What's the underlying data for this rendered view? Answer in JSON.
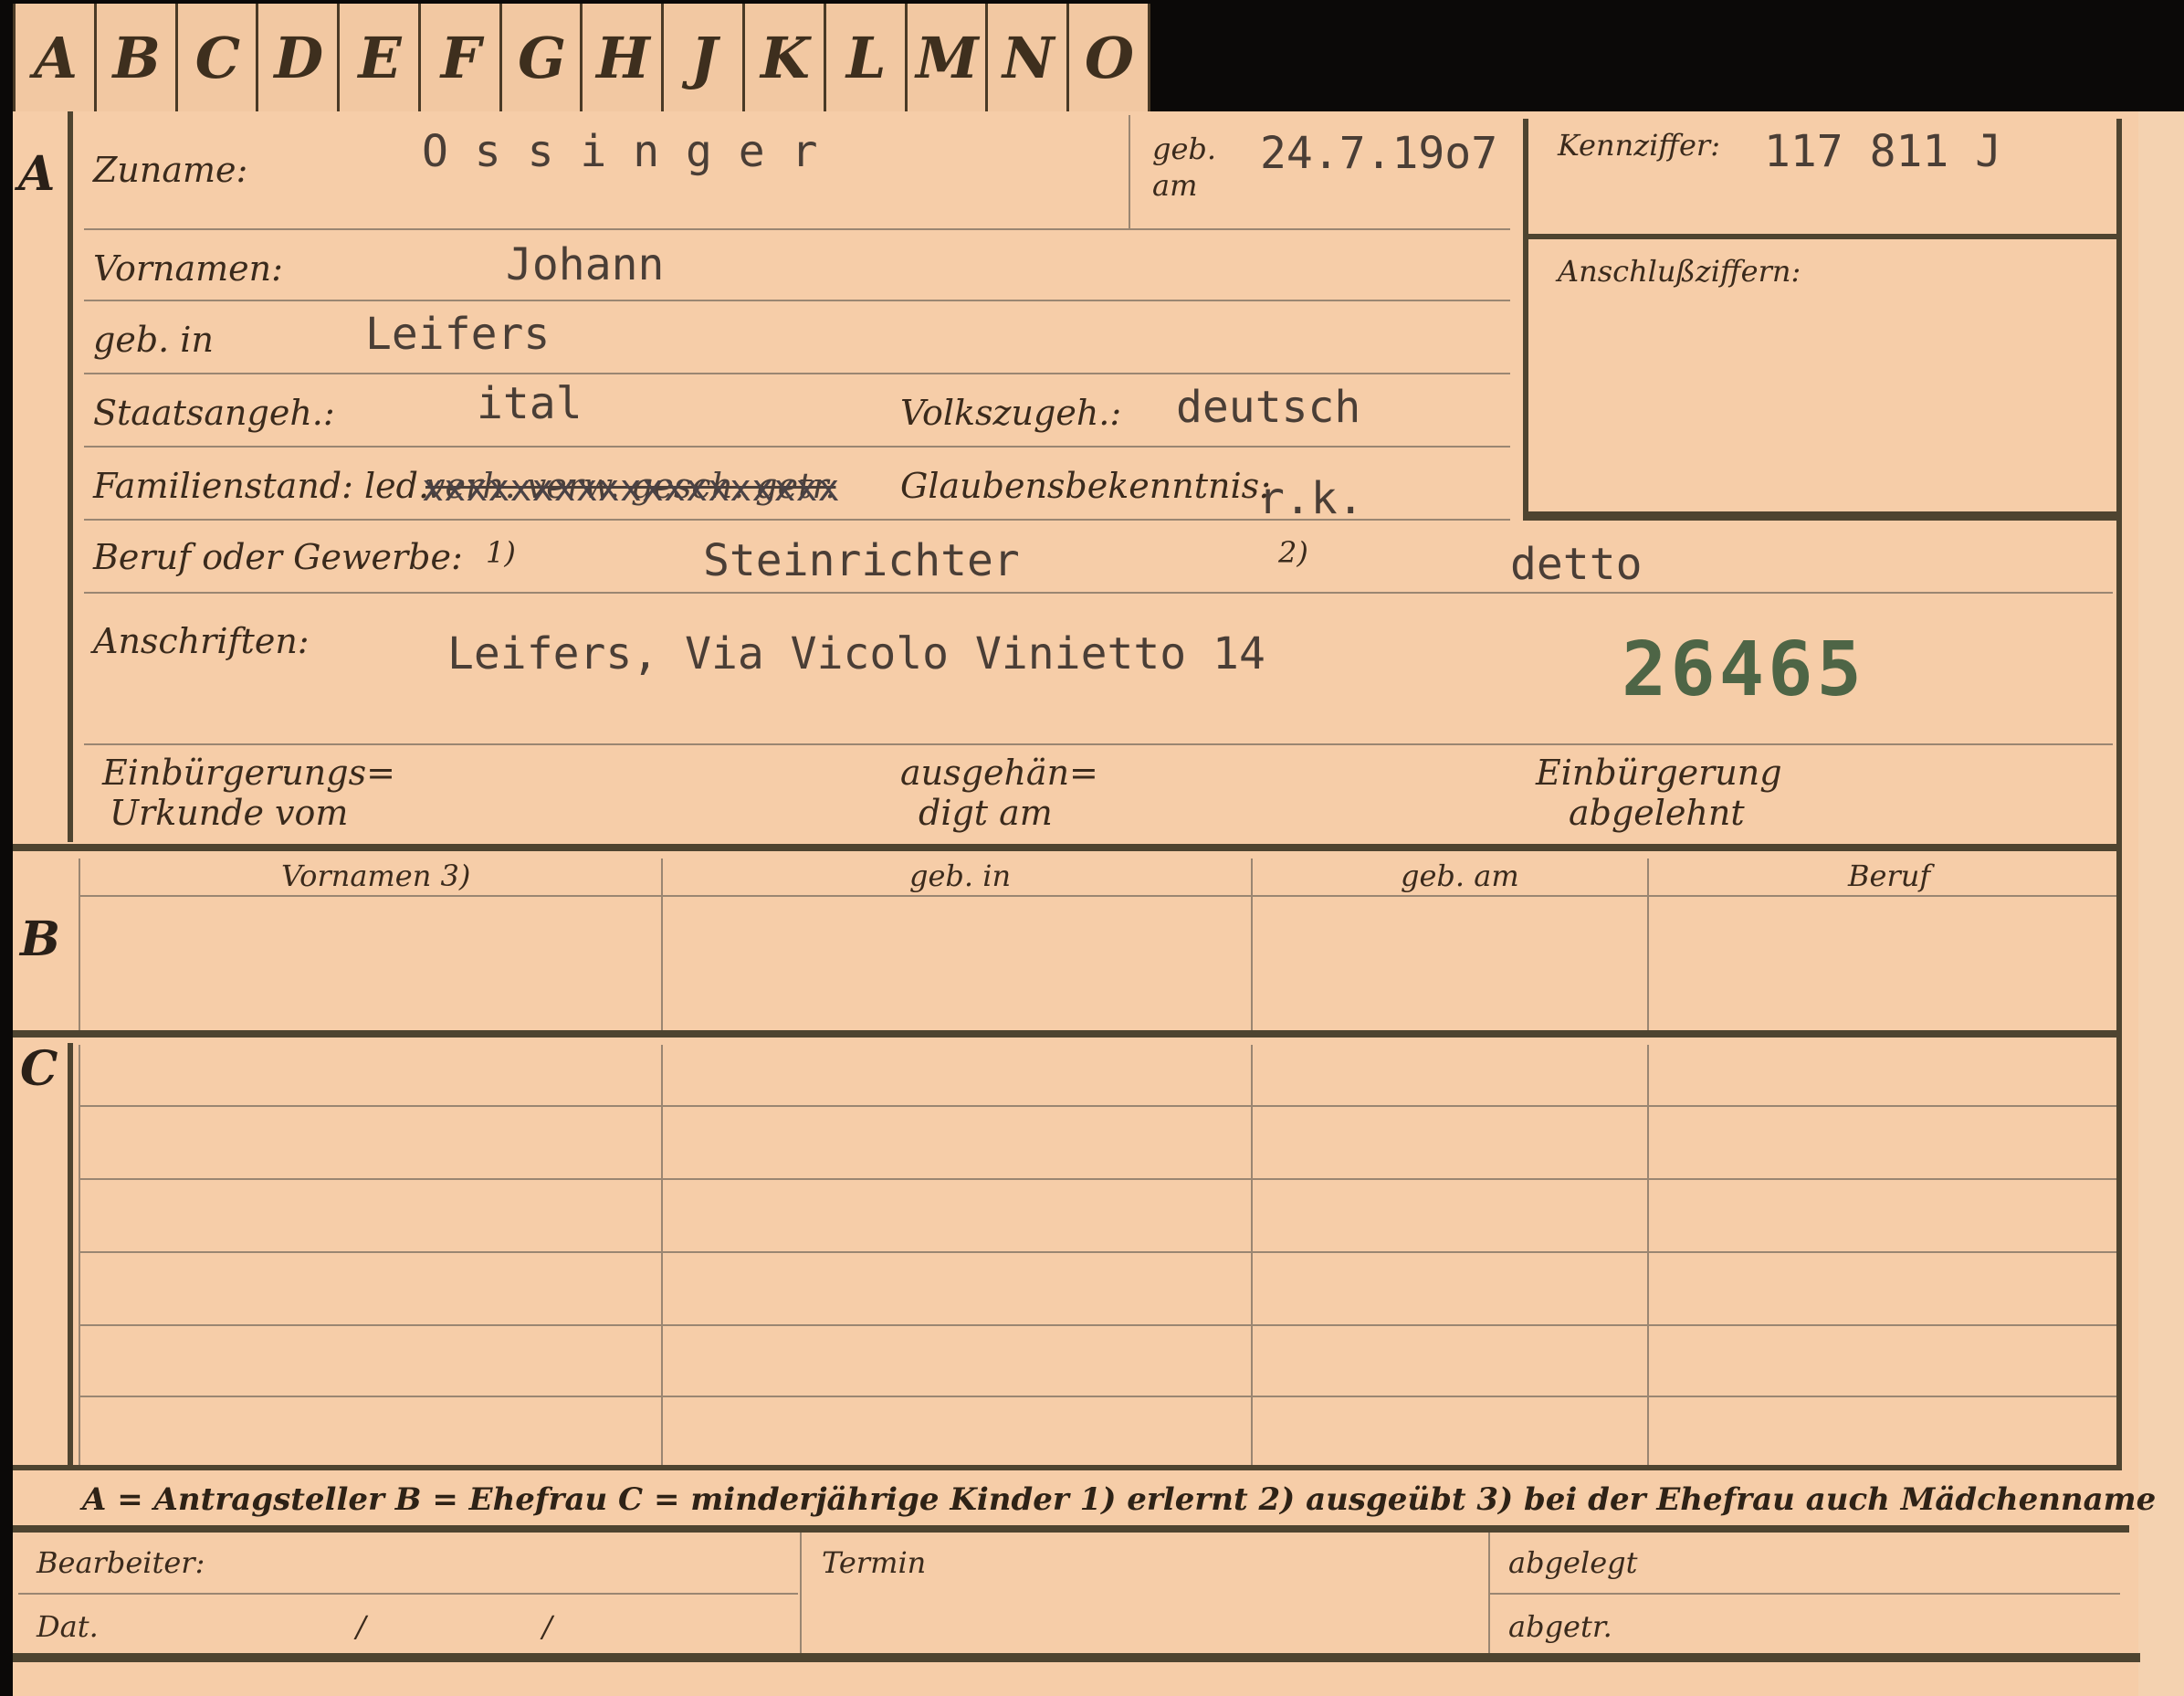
{
  "tabs": [
    "A",
    "B",
    "C",
    "D",
    "E",
    "F",
    "G",
    "H",
    "J",
    "K",
    "L",
    "M",
    "N",
    "O"
  ],
  "sections": {
    "a": "A",
    "b": "B",
    "c": "C"
  },
  "section_a": {
    "zuname_label": "Zuname:",
    "zuname_value": "O s s i n g e r",
    "geb_am_label_1": "geb.",
    "geb_am_label_2": "am",
    "geb_am_value": "24.7.19o7",
    "kennziffer_label": "Kennziffer:",
    "kennziffer_value": "117 811 J",
    "anschluss_label": "Anschlußziffern:",
    "vornamen_label": "Vornamen:",
    "vornamen_value": "Johann",
    "geb_in_label": "geb. in",
    "geb_in_value": "Leifers",
    "staatsangeh_label": "Staatsangeh.:",
    "staatsangeh_value": "ital",
    "volkszugeh_label": "Volkszugeh.:",
    "volkszugeh_value": "deutsch",
    "familienstand_label": "Familienstand: led.",
    "familienstand_struck": "verh. verw. gesch. getr.",
    "familienstand_xs": "xxxxxxxxxxxxxxxxxxx",
    "glaubens_label": "Glaubensbekenntnis:",
    "glaubens_value": "r.k.",
    "beruf_label": "Beruf oder Gewerbe:",
    "beruf_note1": "1)",
    "beruf_value": "Steinrichter",
    "beruf_note2": "2)",
    "beruf_value2": "detto",
    "anschriften_label": "Anschriften:",
    "anschriften_value": "Leifers, Via Vicolo Vinietto 14",
    "stamp_number": "26465",
    "einb_urkunde_1": "Einbürgerungs=",
    "einb_urkunde_2": "Urkunde vom",
    "ausgehaen_1": "ausgehän=",
    "ausgehaen_2": "digt am",
    "einb_abgelehnt_1": "Einbürgerung",
    "einb_abgelehnt_2": "abgelehnt"
  },
  "table": {
    "headers": [
      "Vornamen 3)",
      "geb. in",
      "geb. am",
      "Beruf"
    ]
  },
  "legend": "A = Antragsteller   B = Ehefrau   C = minderjährige Kinder   1) erlernt   2) ausgeübt   3) bei der Ehefrau auch Mädchenname",
  "footer": {
    "bearbeiter": "Bearbeiter:",
    "termin": "Termin",
    "abgelegt": "abgelegt",
    "dat": "Dat.",
    "slash1": "/",
    "slash2": "/",
    "abgetr": "abgetr."
  },
  "colors": {
    "paper": "#f6cda8",
    "ink": "#3a2a1c",
    "typewriter": "#4a3e36",
    "stamp": "#4e6546",
    "background": "#0b0908"
  }
}
